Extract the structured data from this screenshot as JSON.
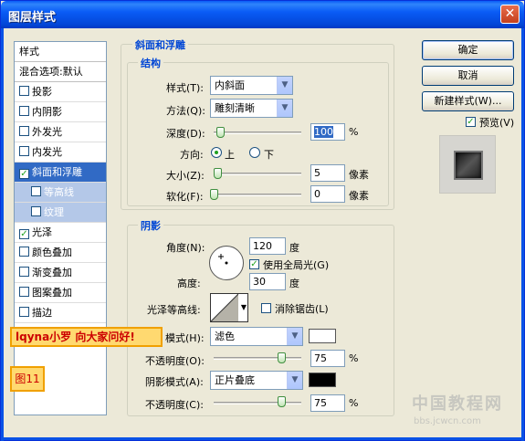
{
  "window": {
    "title": "图层样式",
    "close_glyph": "✕"
  },
  "list": {
    "header": "样式",
    "blend_options": "混合选项:默认",
    "items": [
      {
        "label": "投影",
        "checked": false
      },
      {
        "label": "内阴影",
        "checked": false
      },
      {
        "label": "外发光",
        "checked": false
      },
      {
        "label": "内发光",
        "checked": false
      },
      {
        "label": "斜面和浮雕",
        "checked": true
      },
      {
        "label": "等高线",
        "checked": false
      },
      {
        "label": "纹理",
        "checked": false
      },
      {
        "label": "光泽",
        "checked": true
      },
      {
        "label": "颜色叠加",
        "checked": false
      },
      {
        "label": "渐变叠加",
        "checked": false
      },
      {
        "label": "图案叠加",
        "checked": false
      },
      {
        "label": "描边",
        "checked": false
      }
    ]
  },
  "bevel": {
    "group_title": "斜面和浮雕",
    "structure_title": "结构",
    "style_label": "样式(T):",
    "style_value": "内斜面",
    "technique_label": "方法(Q):",
    "technique_value": "雕刻清晰",
    "depth_label": "深度(D):",
    "depth_value": "100",
    "depth_unit": "%",
    "direction_label": "方向:",
    "direction_up": "上",
    "direction_down": "下",
    "size_label": "大小(Z):",
    "size_value": "5",
    "size_unit": "像素",
    "soften_label": "软化(F):",
    "soften_value": "0",
    "soften_unit": "像素"
  },
  "shading": {
    "group_title": "阴影",
    "angle_label": "角度(N):",
    "angle_value": "120",
    "angle_unit": "度",
    "global_light_label": "使用全局光(G)",
    "altitude_label": "高度:",
    "altitude_value": "30",
    "altitude_unit": "度",
    "gloss_contour_label": "光泽等高线:",
    "antialias_label": "消除锯齿(L)",
    "highlight_mode_label": "模式(H):",
    "highlight_mode_value": "滤色",
    "highlight_color": "#ffffff",
    "highlight_opacity_label": "不透明度(O):",
    "highlight_opacity_value": "75",
    "shadow_mode_label": "阴影模式(A):",
    "shadow_mode_value": "正片叠底",
    "shadow_color": "#000000",
    "shadow_opacity_label": "不透明度(C):",
    "shadow_opacity_value": "75",
    "percent": "%"
  },
  "buttons": {
    "ok": "确定",
    "cancel": "取消",
    "new_style": "新建样式(W)...",
    "preview_label": "预览(V)"
  },
  "overlay": {
    "greeting": "lqyna小罗 向大家问好!",
    "figure": "图11",
    "watermark": "中国教程网",
    "watermark_url": "bbs.jcwcn.com"
  }
}
